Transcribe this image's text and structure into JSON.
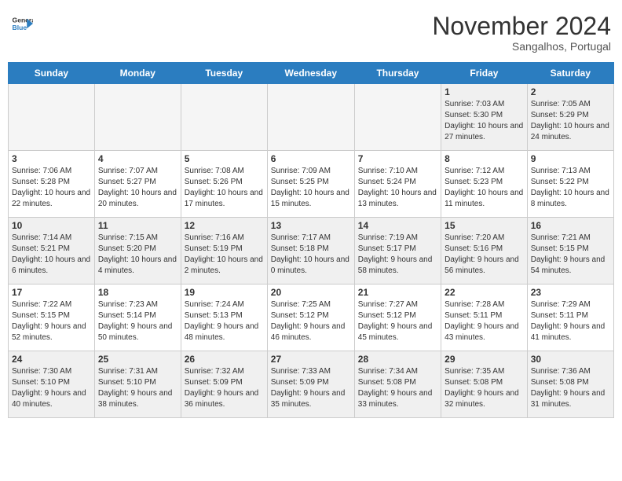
{
  "header": {
    "logo_line1": "General",
    "logo_line2": "Blue",
    "month": "November 2024",
    "location": "Sangalhos, Portugal"
  },
  "weekdays": [
    "Sunday",
    "Monday",
    "Tuesday",
    "Wednesday",
    "Thursday",
    "Friday",
    "Saturday"
  ],
  "weeks": [
    [
      {
        "day": "",
        "info": ""
      },
      {
        "day": "",
        "info": ""
      },
      {
        "day": "",
        "info": ""
      },
      {
        "day": "",
        "info": ""
      },
      {
        "day": "",
        "info": ""
      },
      {
        "day": "1",
        "info": "Sunrise: 7:03 AM\nSunset: 5:30 PM\nDaylight: 10 hours and 27 minutes."
      },
      {
        "day": "2",
        "info": "Sunrise: 7:05 AM\nSunset: 5:29 PM\nDaylight: 10 hours and 24 minutes."
      }
    ],
    [
      {
        "day": "3",
        "info": "Sunrise: 7:06 AM\nSunset: 5:28 PM\nDaylight: 10 hours and 22 minutes."
      },
      {
        "day": "4",
        "info": "Sunrise: 7:07 AM\nSunset: 5:27 PM\nDaylight: 10 hours and 20 minutes."
      },
      {
        "day": "5",
        "info": "Sunrise: 7:08 AM\nSunset: 5:26 PM\nDaylight: 10 hours and 17 minutes."
      },
      {
        "day": "6",
        "info": "Sunrise: 7:09 AM\nSunset: 5:25 PM\nDaylight: 10 hours and 15 minutes."
      },
      {
        "day": "7",
        "info": "Sunrise: 7:10 AM\nSunset: 5:24 PM\nDaylight: 10 hours and 13 minutes."
      },
      {
        "day": "8",
        "info": "Sunrise: 7:12 AM\nSunset: 5:23 PM\nDaylight: 10 hours and 11 minutes."
      },
      {
        "day": "9",
        "info": "Sunrise: 7:13 AM\nSunset: 5:22 PM\nDaylight: 10 hours and 8 minutes."
      }
    ],
    [
      {
        "day": "10",
        "info": "Sunrise: 7:14 AM\nSunset: 5:21 PM\nDaylight: 10 hours and 6 minutes."
      },
      {
        "day": "11",
        "info": "Sunrise: 7:15 AM\nSunset: 5:20 PM\nDaylight: 10 hours and 4 minutes."
      },
      {
        "day": "12",
        "info": "Sunrise: 7:16 AM\nSunset: 5:19 PM\nDaylight: 10 hours and 2 minutes."
      },
      {
        "day": "13",
        "info": "Sunrise: 7:17 AM\nSunset: 5:18 PM\nDaylight: 10 hours and 0 minutes."
      },
      {
        "day": "14",
        "info": "Sunrise: 7:19 AM\nSunset: 5:17 PM\nDaylight: 9 hours and 58 minutes."
      },
      {
        "day": "15",
        "info": "Sunrise: 7:20 AM\nSunset: 5:16 PM\nDaylight: 9 hours and 56 minutes."
      },
      {
        "day": "16",
        "info": "Sunrise: 7:21 AM\nSunset: 5:15 PM\nDaylight: 9 hours and 54 minutes."
      }
    ],
    [
      {
        "day": "17",
        "info": "Sunrise: 7:22 AM\nSunset: 5:15 PM\nDaylight: 9 hours and 52 minutes."
      },
      {
        "day": "18",
        "info": "Sunrise: 7:23 AM\nSunset: 5:14 PM\nDaylight: 9 hours and 50 minutes."
      },
      {
        "day": "19",
        "info": "Sunrise: 7:24 AM\nSunset: 5:13 PM\nDaylight: 9 hours and 48 minutes."
      },
      {
        "day": "20",
        "info": "Sunrise: 7:25 AM\nSunset: 5:12 PM\nDaylight: 9 hours and 46 minutes."
      },
      {
        "day": "21",
        "info": "Sunrise: 7:27 AM\nSunset: 5:12 PM\nDaylight: 9 hours and 45 minutes."
      },
      {
        "day": "22",
        "info": "Sunrise: 7:28 AM\nSunset: 5:11 PM\nDaylight: 9 hours and 43 minutes."
      },
      {
        "day": "23",
        "info": "Sunrise: 7:29 AM\nSunset: 5:11 PM\nDaylight: 9 hours and 41 minutes."
      }
    ],
    [
      {
        "day": "24",
        "info": "Sunrise: 7:30 AM\nSunset: 5:10 PM\nDaylight: 9 hours and 40 minutes."
      },
      {
        "day": "25",
        "info": "Sunrise: 7:31 AM\nSunset: 5:10 PM\nDaylight: 9 hours and 38 minutes."
      },
      {
        "day": "26",
        "info": "Sunrise: 7:32 AM\nSunset: 5:09 PM\nDaylight: 9 hours and 36 minutes."
      },
      {
        "day": "27",
        "info": "Sunrise: 7:33 AM\nSunset: 5:09 PM\nDaylight: 9 hours and 35 minutes."
      },
      {
        "day": "28",
        "info": "Sunrise: 7:34 AM\nSunset: 5:08 PM\nDaylight: 9 hours and 33 minutes."
      },
      {
        "day": "29",
        "info": "Sunrise: 7:35 AM\nSunset: 5:08 PM\nDaylight: 9 hours and 32 minutes."
      },
      {
        "day": "30",
        "info": "Sunrise: 7:36 AM\nSunset: 5:08 PM\nDaylight: 9 hours and 31 minutes."
      }
    ]
  ]
}
